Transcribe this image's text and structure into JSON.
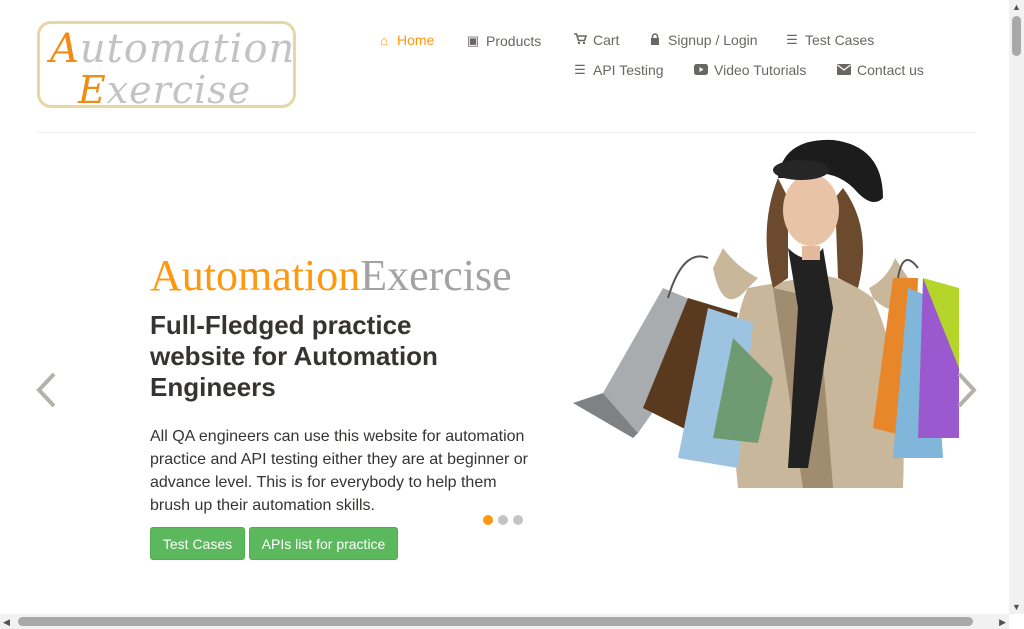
{
  "logo": {
    "line1_cap": "A",
    "line1_rest": "utomation",
    "line2_cap": "E",
    "line2_rest": "xercise"
  },
  "nav": [
    {
      "label": "Home",
      "icon": "home-icon",
      "glyph": "⌂",
      "active": true
    },
    {
      "label": "Products",
      "icon": "briefcase-icon",
      "glyph": "▣"
    },
    {
      "label": "Cart",
      "icon": "cart-icon",
      "glyph": "🛒"
    },
    {
      "label": "Signup / Login",
      "icon": "lock-icon",
      "glyph": "🔒"
    },
    {
      "label": "Test Cases",
      "icon": "list-icon",
      "glyph": "☰"
    },
    {
      "label": "API Testing",
      "icon": "list-icon",
      "glyph": "☰"
    },
    {
      "label": "Video Tutorials",
      "icon": "youtube-icon",
      "glyph": "▶"
    },
    {
      "label": "Contact us",
      "icon": "envelope-icon",
      "glyph": "✉"
    }
  ],
  "slider": {
    "brand_a": "Automation",
    "brand_b": "Exercise",
    "headline": "Full-Fledged practice website for Automation Engineers",
    "paragraph": "All QA engineers can use this website for automation practice and API testing either they are at beginner or advance level. This is for everybody to help them brush up their automation skills.",
    "btn_test_cases": "Test Cases",
    "btn_apis": "APIs list for practice",
    "prev": "‹",
    "next": "›",
    "dots": 3,
    "active_dot": 0
  },
  "colors": {
    "accent": "#fe980f",
    "button": "#5cb85c",
    "text": "#696763",
    "heading": "#363432"
  }
}
